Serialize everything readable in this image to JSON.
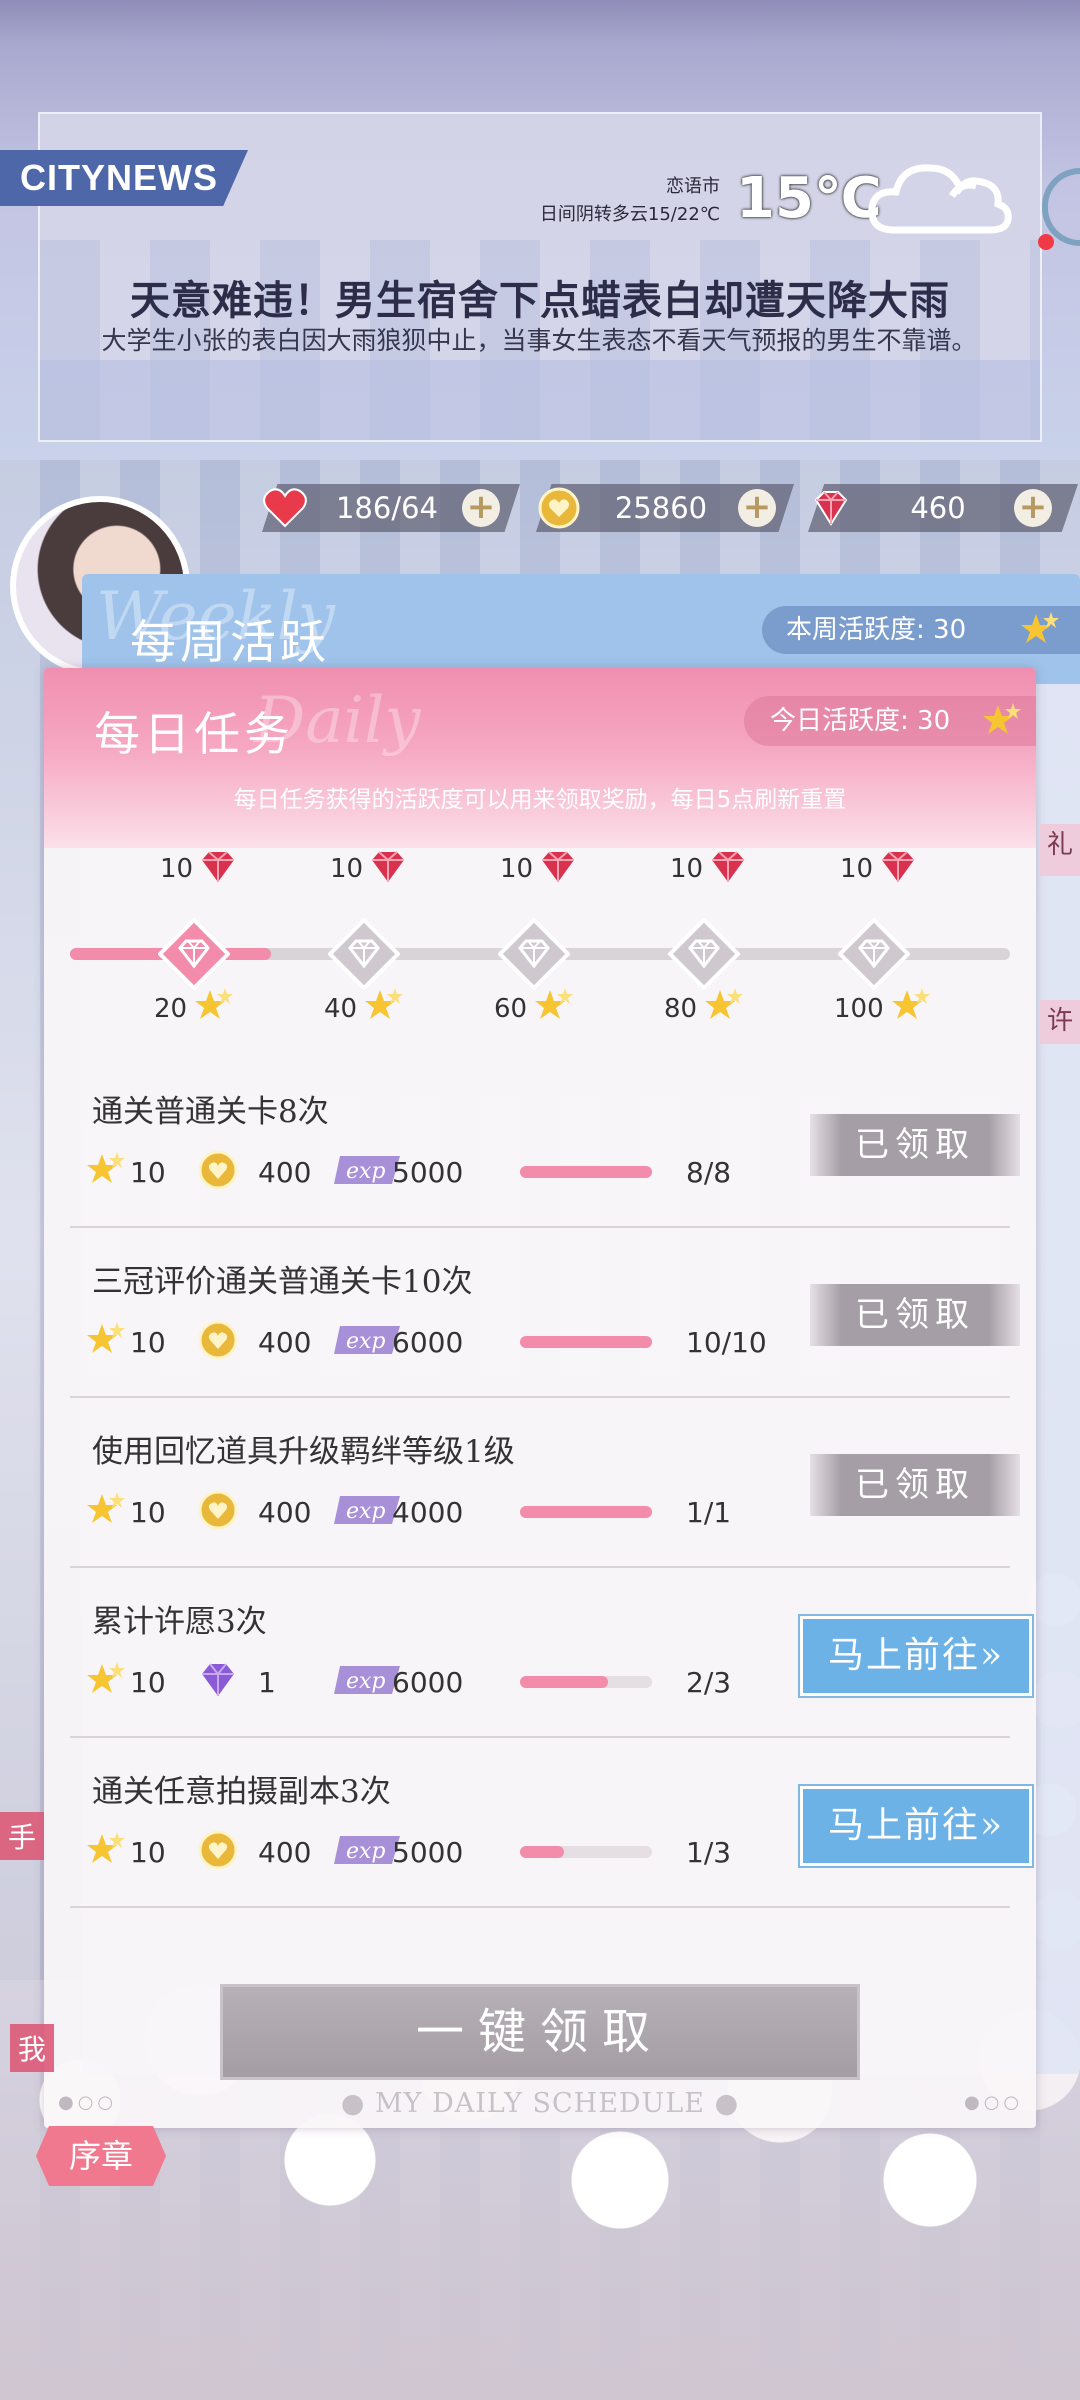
{
  "news": {
    "badge": "CITYNEWS",
    "city": "恋语市",
    "condition": "日间阴转多云15/22℃",
    "temperature": "15℃",
    "headline": "天意难违！男生宿舍下点蜡表白却遭天降大雨",
    "body": "大学生小张的表白因大雨狼狈中止，当事女生表态不看天气预报的男生不靠谱。",
    "icon": "cloud-icon"
  },
  "resources": {
    "stamina": {
      "value": "186/64",
      "icon": "heart-icon"
    },
    "gold": {
      "value": "25860",
      "icon": "coin-icon"
    },
    "diamond": {
      "value": "460",
      "icon": "diamond-icon"
    },
    "plus": "+"
  },
  "weekly": {
    "title": "每周活跃",
    "bg_word": "Weekly",
    "score_label": "本周活跃度: 30"
  },
  "daily": {
    "title": "每日任务",
    "bg_word": "Daily",
    "score_label": "今日活跃度: 30",
    "description": "每日任务获得的活跃度可以用来领取奖励，每日5点刷新重置",
    "current_points": 30,
    "max_points": 100,
    "milestones": [
      {
        "reward": "10",
        "points": "20",
        "reached": true
      },
      {
        "reward": "10",
        "points": "40",
        "reached": false
      },
      {
        "reward": "10",
        "points": "60",
        "reached": false
      },
      {
        "reward": "10",
        "points": "80",
        "reached": false
      },
      {
        "reward": "10",
        "points": "100",
        "reached": false
      }
    ],
    "tasks": [
      {
        "name": "通关普通关卡8次",
        "stars": "10",
        "item_icon": "coin-icon",
        "item": "400",
        "exp": "5000",
        "progress": "8/8",
        "fraction": 1.0,
        "action": "已领取",
        "state": "claimed"
      },
      {
        "name": "三冠评价通关普通关卡10次",
        "stars": "10",
        "item_icon": "coin-icon",
        "item": "400",
        "exp": "6000",
        "progress": "10/10",
        "fraction": 1.0,
        "action": "已领取",
        "state": "claimed"
      },
      {
        "name": "使用回忆道具升级羁绊等级1级",
        "stars": "10",
        "item_icon": "coin-icon",
        "item": "400",
        "exp": "4000",
        "progress": "1/1",
        "fraction": 1.0,
        "action": "已领取",
        "state": "claimed"
      },
      {
        "name": "累计许愿3次",
        "stars": "10",
        "item_icon": "purple-gem-icon",
        "item": "1",
        "exp": "6000",
        "progress": "2/3",
        "fraction": 0.667,
        "action": "马上前往»",
        "state": "go"
      },
      {
        "name": "通关任意拍摄副本3次",
        "stars": "10",
        "item_icon": "coin-icon",
        "item": "400",
        "exp": "5000",
        "progress": "1/3",
        "fraction": 0.333,
        "action": "马上前往»",
        "state": "go"
      }
    ],
    "exp_label": "exp",
    "claim_all": "一键领取",
    "footer": "MY DAILY SCHEDULE"
  },
  "side": {
    "gift": "礼",
    "wish": "许",
    "handbook": "手",
    "mine": "我",
    "chapter": "序章"
  }
}
